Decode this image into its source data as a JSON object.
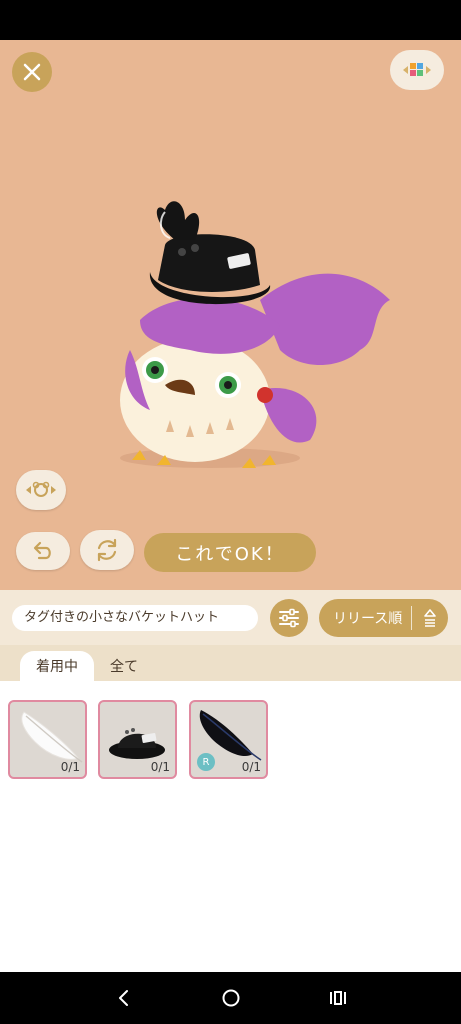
{
  "stage": {
    "background": "#e8b793",
    "confirm_label": "これでOK！"
  },
  "icons": {
    "close": "close-icon",
    "palette": "color-palette-icon",
    "view": "camera-view-icon",
    "undo": "undo-icon",
    "rotate": "rotate-icon",
    "filter": "filter-sliders-icon",
    "sort": "sort-order-icon"
  },
  "toolbar": {
    "search_value": "タグ付きの小さなバケットハット",
    "sort_label": "リリース順"
  },
  "tabs": [
    {
      "label": "着用中",
      "active": true
    },
    {
      "label": "全て",
      "active": false
    }
  ],
  "items": [
    {
      "name": "white-feather",
      "count": "0/1",
      "rare": false
    },
    {
      "name": "black-bucket-hat",
      "count": "0/1",
      "rare": false
    },
    {
      "name": "black-feather",
      "count": "0/1",
      "rare": true,
      "badge": "R"
    }
  ],
  "colors": {
    "accent": "#c8a35a",
    "panel": "#f3e8d7",
    "item_border": "#e08aa0"
  }
}
